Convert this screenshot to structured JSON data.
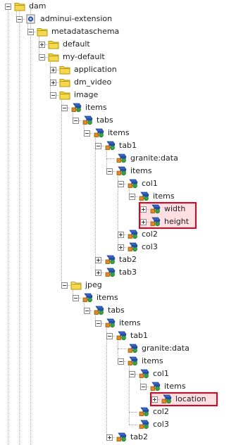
{
  "tree": [
    {
      "label": "dam",
      "type": "folder",
      "depth": 0,
      "toggle": "minus"
    },
    {
      "label": "adminui-extension",
      "type": "node",
      "depth": 1,
      "toggle": "minus"
    },
    {
      "label": "metadataschema",
      "type": "folder",
      "depth": 2,
      "toggle": "minus"
    },
    {
      "label": "default",
      "type": "folder",
      "depth": 3,
      "toggle": "plus"
    },
    {
      "label": "my-default",
      "type": "folder",
      "depth": 3,
      "toggle": "minus"
    },
    {
      "label": "application",
      "type": "folder",
      "depth": 4,
      "toggle": "plus"
    },
    {
      "label": "dm_video",
      "type": "folder",
      "depth": 4,
      "toggle": "plus"
    },
    {
      "label": "image",
      "type": "folder",
      "depth": 4,
      "toggle": "minus"
    },
    {
      "label": "items",
      "type": "component",
      "depth": 5,
      "toggle": "minus"
    },
    {
      "label": "tabs",
      "type": "component",
      "depth": 6,
      "toggle": "minus"
    },
    {
      "label": "items",
      "type": "component",
      "depth": 7,
      "toggle": "minus"
    },
    {
      "label": "tab1",
      "type": "component",
      "depth": 8,
      "toggle": "minus"
    },
    {
      "label": "granite:data",
      "type": "component",
      "depth": 9,
      "toggle": "none"
    },
    {
      "label": "items",
      "type": "component",
      "depth": 9,
      "toggle": "minus"
    },
    {
      "label": "col1",
      "type": "component",
      "depth": 10,
      "toggle": "minus"
    },
    {
      "label": "items",
      "type": "component",
      "depth": 11,
      "toggle": "minus"
    },
    {
      "label": "width",
      "type": "component",
      "depth": 12,
      "toggle": "plus",
      "highlighted": true
    },
    {
      "label": "height",
      "type": "component",
      "depth": 12,
      "toggle": "plus",
      "highlighted": true
    },
    {
      "label": "col2",
      "type": "component",
      "depth": 10,
      "toggle": "plus"
    },
    {
      "label": "col3",
      "type": "component",
      "depth": 10,
      "toggle": "plus"
    },
    {
      "label": "tab2",
      "type": "component",
      "depth": 8,
      "toggle": "plus"
    },
    {
      "label": "tab3",
      "type": "component",
      "depth": 8,
      "toggle": "plus"
    },
    {
      "label": "jpeg",
      "type": "folder-open",
      "depth": 5,
      "toggle": "minus"
    },
    {
      "label": "items",
      "type": "component",
      "depth": 6,
      "toggle": "minus"
    },
    {
      "label": "tabs",
      "type": "component",
      "depth": 7,
      "toggle": "minus"
    },
    {
      "label": "items",
      "type": "component",
      "depth": 8,
      "toggle": "minus"
    },
    {
      "label": "tab1",
      "type": "component",
      "depth": 9,
      "toggle": "minus"
    },
    {
      "label": "granite:data",
      "type": "component",
      "depth": 10,
      "toggle": "none"
    },
    {
      "label": "items",
      "type": "component",
      "depth": 10,
      "toggle": "minus"
    },
    {
      "label": "col1",
      "type": "component",
      "depth": 11,
      "toggle": "minus"
    },
    {
      "label": "items",
      "type": "component",
      "depth": 12,
      "toggle": "minus"
    },
    {
      "label": "location",
      "type": "component",
      "depth": 13,
      "toggle": "plus",
      "highlighted": true
    },
    {
      "label": "col2",
      "type": "component",
      "depth": 11,
      "toggle": "none"
    },
    {
      "label": "col3",
      "type": "component",
      "depth": 11,
      "toggle": "none"
    },
    {
      "label": "tab2",
      "type": "component",
      "depth": 9,
      "toggle": "plus"
    }
  ],
  "colors": {
    "folder_fill": "#f4d94f",
    "folder_stroke": "#b7960a",
    "highlight_border": "#e5001c",
    "highlight_fill": "#ffc9cf",
    "component_blue": "#3566c7",
    "component_green": "#3aa338",
    "component_orange": "#e08a1c"
  }
}
